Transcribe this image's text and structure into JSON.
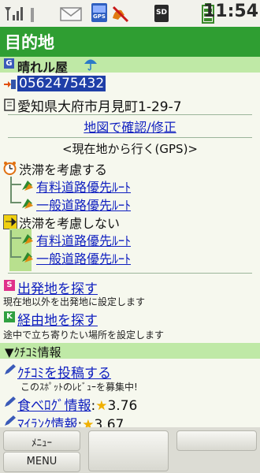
{
  "status_bar": {
    "time": "11:54",
    "icons": [
      "signal-antenna-icon",
      "mail-icon",
      "gps-icon",
      "no-call-icon",
      "sd-card-icon",
      "battery-icon"
    ],
    "gps_text": "GPS",
    "sd_text": "SD"
  },
  "title": "目的地",
  "place": {
    "badge": "G",
    "name": "晴れル屋",
    "phone": "0562475432",
    "address": "愛知県大府市月見町1-29-7"
  },
  "confirm_link": "地図で確認/修正",
  "gps_header": "<現在地から行く(GPS)>",
  "options": [
    {
      "label": "渋滞を考慮する",
      "routes": [
        "有料道路優先ﾙｰﾄ",
        "一般道路優先ﾙｰﾄ"
      ]
    },
    {
      "label": "渋滞を考慮しない",
      "routes": [
        "有料道路優先ﾙｰﾄ",
        "一般道路優先ﾙｰﾄ"
      ]
    }
  ],
  "departure": {
    "badge": "S",
    "label": "出発地を探す",
    "note": "現在地以外を出発地に設定します"
  },
  "waypoint": {
    "badge": "K",
    "label": "経由地を探す",
    "note": "途中で立ち寄りたい場所を設定します"
  },
  "kuchikomi": {
    "header": "▼ｸﾁｺﾐ情報",
    "post_label": "ｸﾁｺﾐを投稿する",
    "review_note": "このｽﾎﾟｯﾄのﾚﾋﾞｭｰを募集中!",
    "tabelog_label": "食べﾛｸﾞ情報",
    "tabelog_score": "3.76",
    "next_label": "ﾏｲﾗﾝｸ情報",
    "next_score": "3.67"
  },
  "softkeys": {
    "menu_label": "ﾒﾆｭｰ",
    "menu2_label": "MENU"
  },
  "colors": {
    "title_bar": "#2f9e32",
    "section_header": "#bfe9a6",
    "link": "#1020c0",
    "phone_highlight": "#1f3fa8"
  }
}
